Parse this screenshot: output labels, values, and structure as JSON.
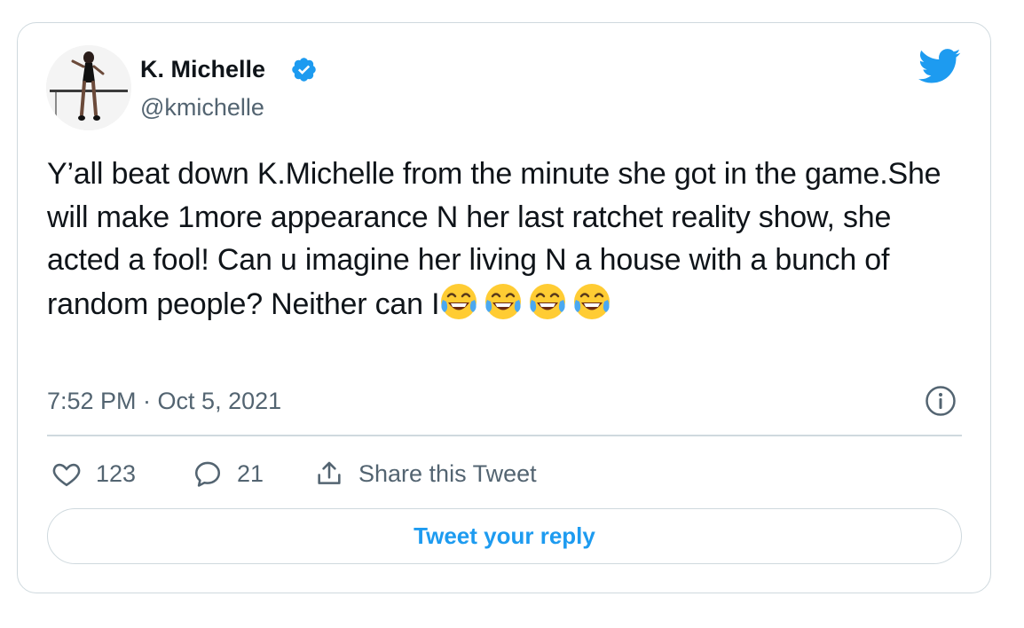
{
  "author": {
    "display_name": "K. Michelle",
    "handle": "@kmichelle",
    "verified": true
  },
  "tweet": {
    "text_before_emoji": "Y’all beat down K.Michelle from the minute she got in the game.She will make 1more appearance N her last ratchet reality show, she acted a fool! Can u imagine her living N a house with a bunch of random people? Neither can I",
    "emoji_name": "face-with-tears-of-joy",
    "emoji_count": 4
  },
  "timestamp": "7:52 PM · Oct 5, 2021",
  "actions": {
    "like_count": "123",
    "reply_count": "21",
    "share_label": "Share this Tweet"
  },
  "reply_button_label": "Tweet your reply",
  "icons": {
    "brand": "twitter-bird-icon",
    "verified": "verified-badge-icon",
    "info": "info-icon",
    "like": "heart-icon",
    "reply": "speech-bubble-icon",
    "share": "share-upload-icon"
  },
  "colors": {
    "twitter_blue": "#1d9bf0",
    "text_primary": "#0f1419",
    "text_secondary": "#536471",
    "border": "#cfd9de"
  }
}
